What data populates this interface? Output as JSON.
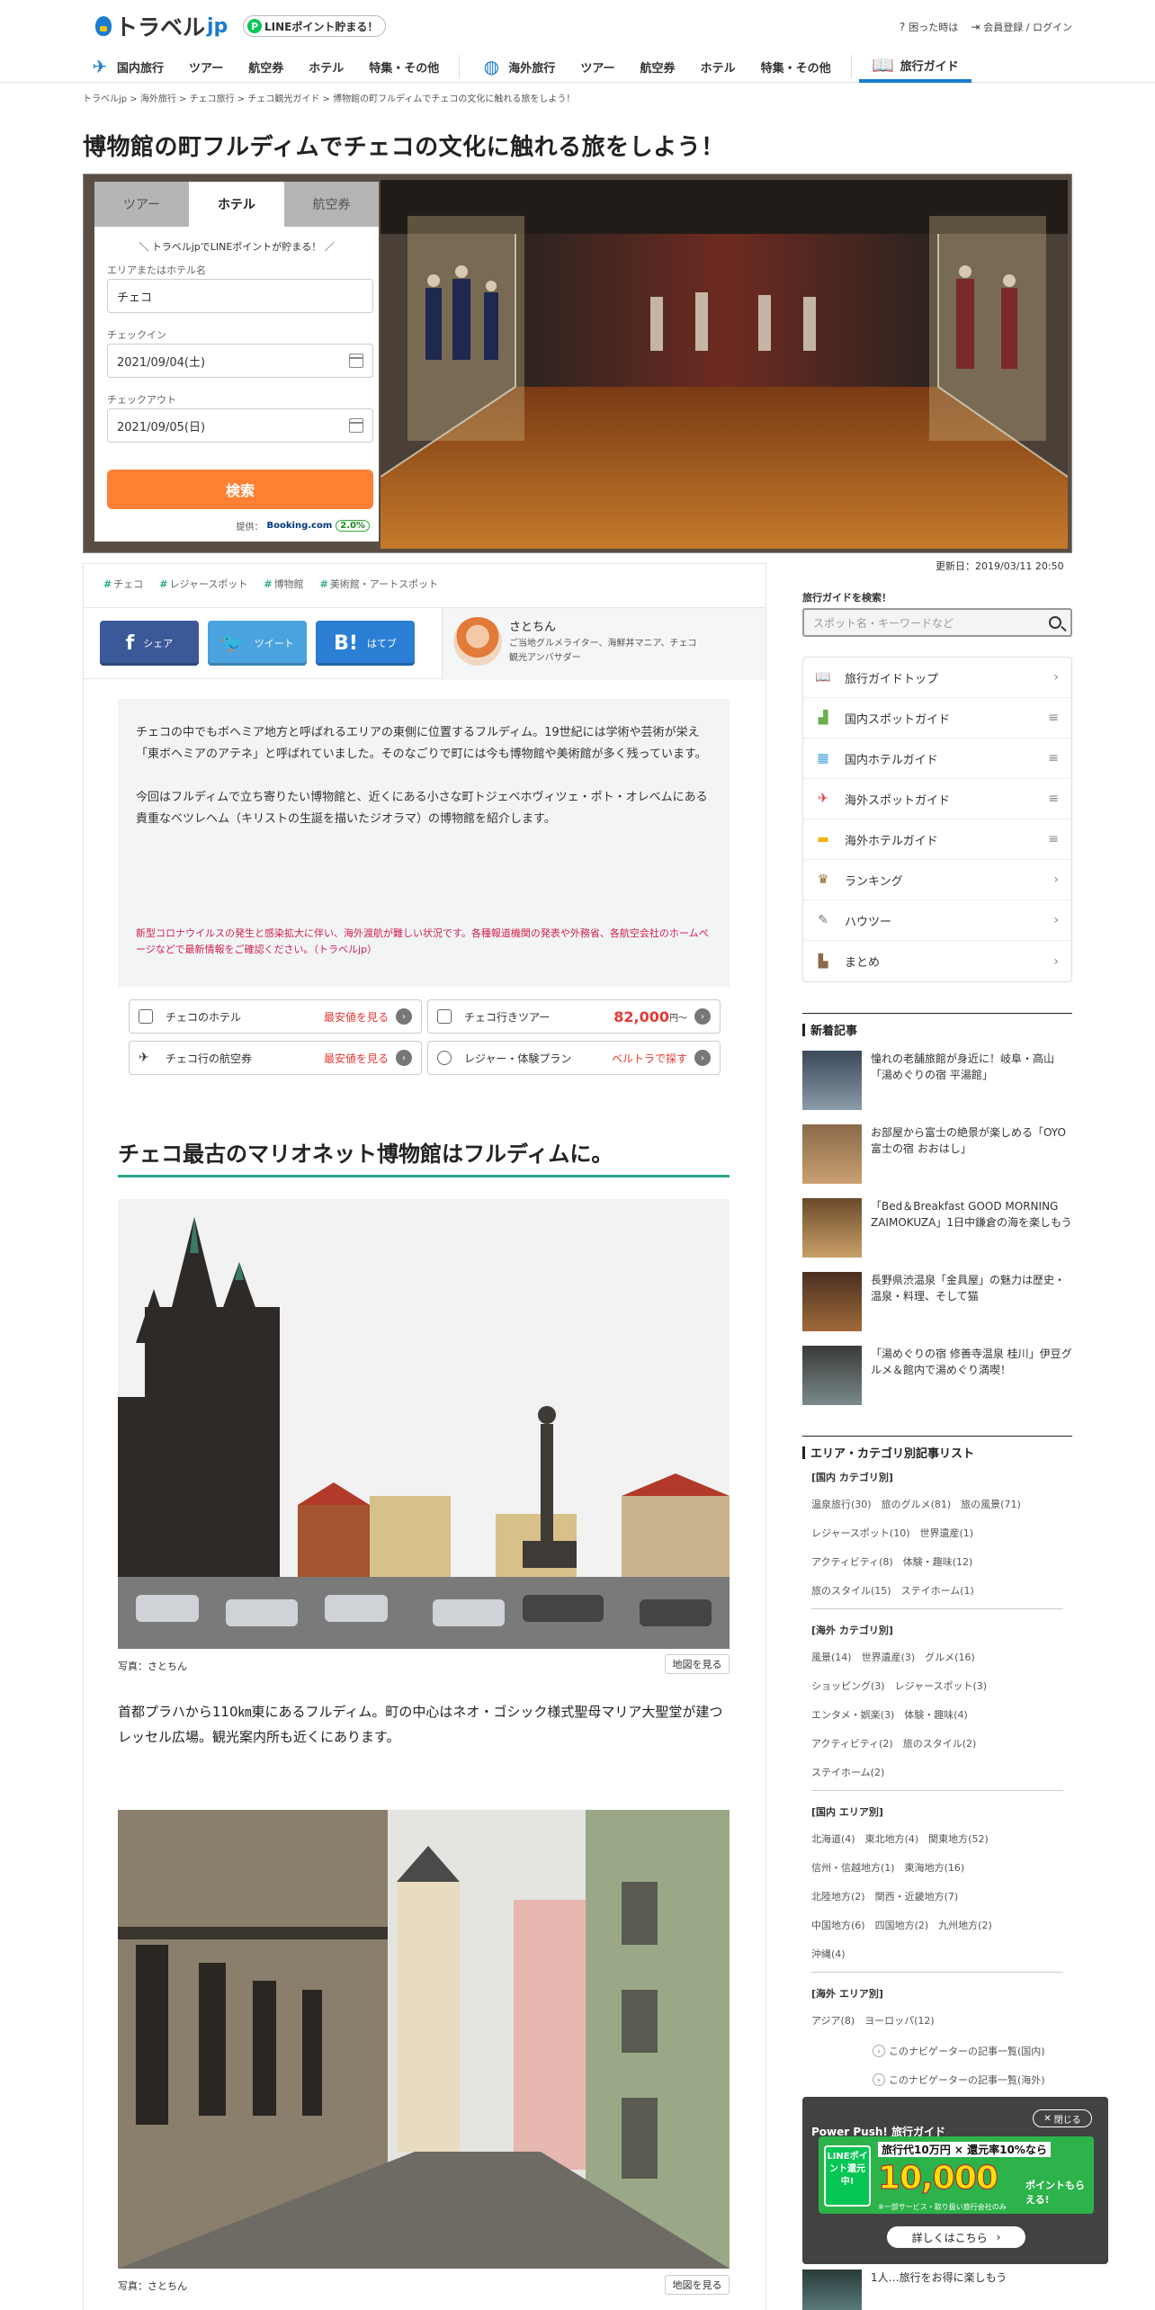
{
  "header": {
    "logo_text": "トラベル",
    "logo_suffix": "jp",
    "line_badge": "LINEポイント貯まる！",
    "util": [
      "困った時は",
      "会員登録 / ログイン"
    ]
  },
  "nav": {
    "domestic": {
      "label": "国内旅行",
      "items": [
        "ツアー",
        "航空券",
        "ホテル",
        "特集・その他"
      ]
    },
    "overseas": {
      "label": "海外旅行",
      "items": [
        "ツアー",
        "航空券",
        "ホテル",
        "特集・その他"
      ]
    },
    "guide": "旅行ガイド"
  },
  "breadcrumb": "トラベルjp  >  海外旅行  >  チェコ旅行  >  チェコ観光ガイド  >  博物館の町フルディムでチェコの文化に触れる旅をしよう！",
  "page_title": "博物館の町フルディムでチェコの文化に触れる旅をしよう！",
  "booking": {
    "tabs": [
      "ツアー",
      "ホテル",
      "航空券"
    ],
    "banner": "＼ トラベルjpでLINEポイントが貯まる！ ／",
    "area_label": "エリアまたはホテル名",
    "area_value": "チェコ",
    "checkin_label": "チェックイン",
    "checkin_value": "2021/09/04(土)",
    "checkout_label": "チェックアウト",
    "checkout_value": "2021/09/05(日)",
    "search": "検索",
    "provider_prefix": "提供：",
    "provider": "Booking.com",
    "point": "2.0%"
  },
  "updated": "更新日：2019/03/11 20:50",
  "tags": [
    "チェコ",
    "レジャースポット",
    "博物館",
    "美術館・アートスポット"
  ],
  "share": {
    "facebook": "シェア",
    "twitter": "ツイート",
    "hatena": "はてブ"
  },
  "author": {
    "name": "さとちん",
    "desc": "ご当地グルメライター、海鮮丼マニア、チェコ観光アンバサダー"
  },
  "intro": {
    "p1": "チェコの中でもボヘミア地方と呼ばれるエリアの東側に位置するフルディム。19世紀には学術や芸術が栄え「東ボヘミアのアテネ」と呼ばれていました。そのなごりで町には今も博物館や美術館が多く残っています。",
    "p2": "今回はフルディムで立ち寄りたい博物館と、近くにある小さな町トジェベホヴィツェ・ポト・オレベムにある貴重なベツレヘム（キリストの生誕を描いたジオラマ）の博物館を紹介します。",
    "notice": "新型コロナウイルスの発生と感染拡大に伴い、海外渡航が難しい状況です。各種報道機関の発表や外務省、各航空会社のホームページなどで最新情報をご確認ください。（トラベルjp）"
  },
  "quicklinks": [
    {
      "label": "チェコのホテル",
      "action": "最安値を見る"
    },
    {
      "label": "チェコ行きツアー",
      "price": "82,000",
      "suffix": "円～"
    },
    {
      "label": "チェコ行の航空券",
      "action": "最安値を見る"
    },
    {
      "label": "レジャー・体験プラン",
      "action": "ベルトラで探す"
    }
  ],
  "section1": {
    "heading": "チェコ最古のマリオネット博物館はフルディムに。",
    "caption": "写真：さとちん",
    "map": "地図を見る",
    "body": "首都プラハから110㎞東にあるフルディム。町の中心はネオ・ゴシック様式聖母マリア大聖堂が建つレッセル広場。観光案内所も近くにあります。"
  },
  "section2": {
    "caption": "写真：さとちん",
    "map": "地図を見る"
  },
  "sidebar": {
    "search_label": "旅行ガイドを検索！",
    "search_placeholder": "スポット名・キーワードなど",
    "menu": [
      "旅行ガイドトップ",
      "国内スポットガイド",
      "国内ホテルガイド",
      "海外スポットガイド",
      "海外ホテルガイド",
      "ランキング",
      "ハウツー",
      "まとめ"
    ],
    "news_title": "新着記事",
    "news": [
      "憧れの老舗旅館が身近に！岐阜・高山「湯めぐりの宿 平湯館」",
      "お部屋から富士の絶景が楽しめる「OYO 富士の宿 おおはし」",
      "「Bed＆Breakfast GOOD MORNING ZAIMOKUZA」1日中鎌倉の海を楽しもう",
      "長野県渋温泉「金具屋」の魅力は歴史・温泉・料理、そして猫",
      "「湯めぐりの宿 修善寺温泉 桂川」伊豆グルメ＆館内で湯めぐり満喫！"
    ],
    "cat_title": "エリア・カテゴリ別記事リスト",
    "cats": [
      {
        "title": "[国内 カテゴリ別]",
        "lines": [
          "温泉旅行(30)　旅のグルメ(81)　旅の風景(71)",
          "レジャースポット(10)　世界遺産(1)",
          "アクティビティ(8)　体験・趣味(12)",
          "旅のスタイル(15)　ステイホーム(1)"
        ]
      },
      {
        "title": "[海外 カテゴリ別]",
        "lines": [
          "風景(14)　世界遺産(3)　グルメ(16)",
          "ショッピング(3)　レジャースポット(3)",
          "エンタメ・娯楽(3)　体験・趣味(4)",
          "アクティビティ(2)　旅のスタイル(2)",
          "ステイホーム(2)"
        ]
      },
      {
        "title": "[国内 エリア別]",
        "lines": [
          "北海道(4)　東北地方(4)　関東地方(52)",
          "信州・信越地方(1)　東海地方(16)",
          "北陸地方(2)　関西・近畿地方(7)",
          "中国地方(6)　四国地方(2)　九州地方(2)",
          "沖縄(4)"
        ]
      },
      {
        "title": "[海外 エリア別]",
        "lines": [
          "アジア(8)　ヨーロッパ(12)"
        ]
      }
    ],
    "navlinks": [
      "このナビゲーターの記事一覧(国内)",
      "このナビゲーターの記事一覧(海外)"
    ]
  },
  "popup": {
    "close": "閉じる",
    "title": "Power Push! 旅行ガイド",
    "banner_line": "LINEポイント還元中!",
    "banner_head": "旅行代10万円 × 還元率10%なら",
    "banner_big": "10,000",
    "banner_unit": "ポイントもらえる!",
    "banner_note": "※一部サービス・取り扱い旅行会社のみ",
    "more": "詳しくはこちら",
    "behind": "1人…旅行をお得に楽しもう"
  }
}
